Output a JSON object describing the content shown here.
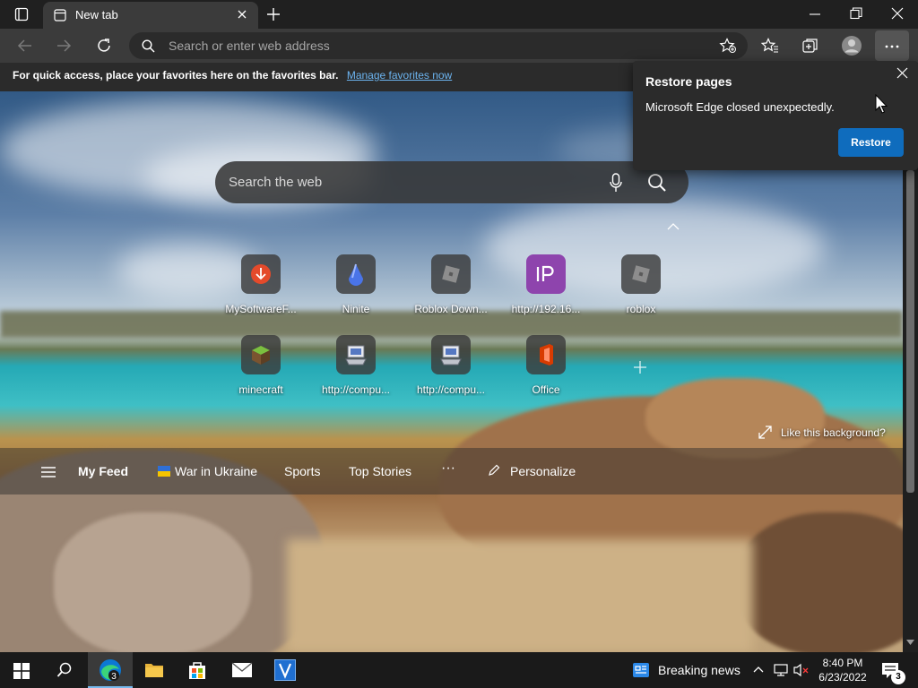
{
  "browser": {
    "tab_title": "New tab",
    "address_placeholder": "Search or enter web address"
  },
  "favorites_bar": {
    "message": "For quick access, place your favorites here on the favorites bar.",
    "link": "Manage favorites now"
  },
  "newtab": {
    "search_placeholder": "Search the web",
    "tiles": [
      {
        "label": "MySoftwareF...",
        "icon": "download-icon",
        "color": "#e44a2b"
      },
      {
        "label": "Ninite",
        "icon": "ninite-icon",
        "color": "#4a74e8"
      },
      {
        "label": "Roblox Down...",
        "icon": "roblox-icon",
        "color": "#9a9a9a"
      },
      {
        "label": "http://192.16...",
        "icon": "ip-icon",
        "color": "#8e44ad"
      },
      {
        "label": "roblox",
        "icon": "roblox-icon",
        "color": "#9a9a9a"
      },
      {
        "label": "minecraft",
        "icon": "minecraft-icon",
        "color": "#6a9a3a"
      },
      {
        "label": "http://compu...",
        "icon": "computer-icon",
        "color": "#c0c4cc"
      },
      {
        "label": "http://compu...",
        "icon": "computer-icon",
        "color": "#c0c4cc"
      },
      {
        "label": "Office",
        "icon": "office-icon",
        "color": "#d83b01"
      }
    ],
    "like_background": "Like this background?"
  },
  "feed": {
    "my_feed": "My Feed",
    "items": [
      "War in Ukraine",
      "Sports",
      "Top Stories"
    ],
    "more": "···",
    "personalize": "Personalize"
  },
  "restore_popup": {
    "title": "Restore pages",
    "message": "Microsoft Edge closed unexpectedly.",
    "button": "Restore"
  },
  "taskbar": {
    "news": "Breaking news",
    "time": "8:40 PM",
    "date": "6/23/2022",
    "notification_count": "3"
  },
  "colors": {
    "accent": "#0f6cbd",
    "link": "#6cb4f0"
  }
}
